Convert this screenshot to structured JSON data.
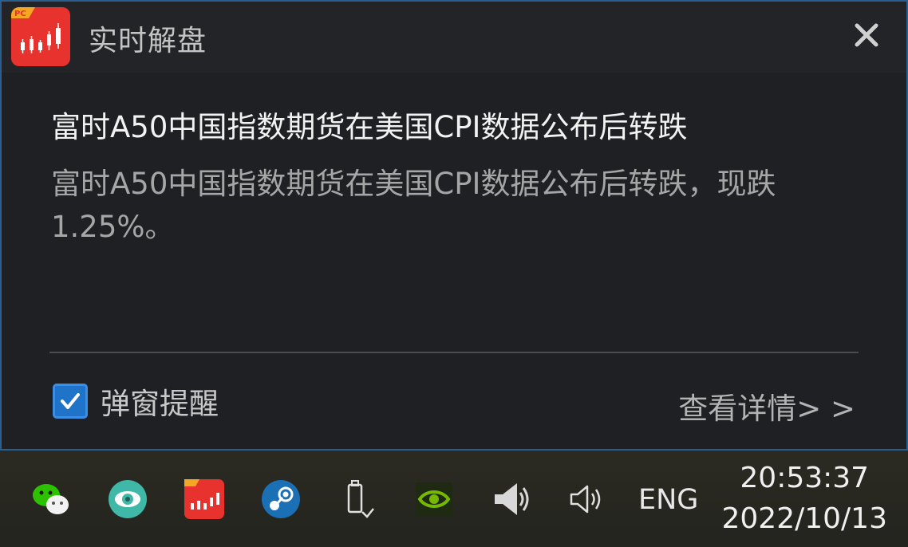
{
  "popup": {
    "app_title": "实时解盘",
    "app_logo_badge": "PC",
    "headline": "富时A50中国指数期货在美国CPI数据公布后转跌",
    "body": "富时A50中国指数期货在美国CPI数据公布后转跌，现跌1.25%。",
    "checkbox_label": "弹窗提醒",
    "checkbox_checked": true,
    "details_link": "查看详情> >",
    "colors": {
      "accent": "#1f73c9",
      "border": "#2a5f8f",
      "logo": "#e8322d"
    }
  },
  "taskbar": {
    "tray_icons": [
      "wechat-icon",
      "eye-care-icon",
      "stock-app-icon",
      "steam-icon",
      "usb-device-icon",
      "nvidia-icon",
      "speaker-device-icon",
      "volume-icon"
    ],
    "language": "ENG",
    "time": "20:53:37",
    "date": "2022/10/13"
  }
}
